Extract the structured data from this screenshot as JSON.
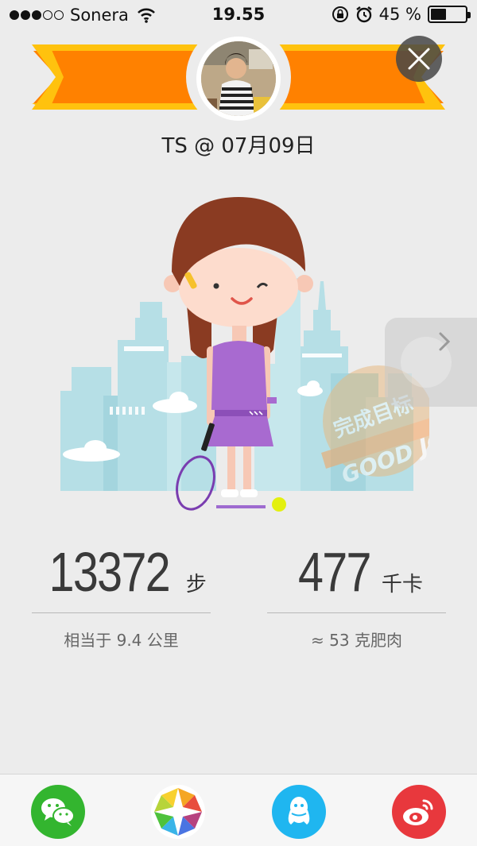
{
  "status_bar": {
    "carrier": "Sonera",
    "time": "19.55",
    "battery_text": "45 %",
    "battery_level": 0.45,
    "icons": [
      "signal-dots-icon",
      "wifi-icon",
      "orientation-lock-icon",
      "alarm-icon",
      "battery-icon"
    ]
  },
  "header": {
    "title": "TS @ 07月09日",
    "close_icon": "close-icon"
  },
  "illustration": {
    "watermark_text": "完成目标 GOOD JOB"
  },
  "stats": {
    "steps": {
      "value": "13372",
      "unit": "步",
      "subtitle": "相当于 9.4 公里"
    },
    "calories": {
      "value": "477",
      "unit": "千卡",
      "subtitle": "≈ 53 克肥肉"
    }
  },
  "share": {
    "items": [
      {
        "name": "wechat",
        "icon": "wechat-icon",
        "color": "#33b52f"
      },
      {
        "name": "moments",
        "icon": "moments-icon",
        "color": "#ffffff"
      },
      {
        "name": "qq",
        "icon": "qq-icon",
        "color": "#1fb6f0"
      },
      {
        "name": "weibo",
        "icon": "weibo-icon",
        "color": "#e8383d"
      }
    ]
  },
  "colors": {
    "banner_orange": "#ff8100",
    "banner_yellow": "#ffc20e",
    "dress_purple": "#a86ad0",
    "hair_brown": "#8a3b22",
    "city_blue": "#b6dfe6"
  }
}
